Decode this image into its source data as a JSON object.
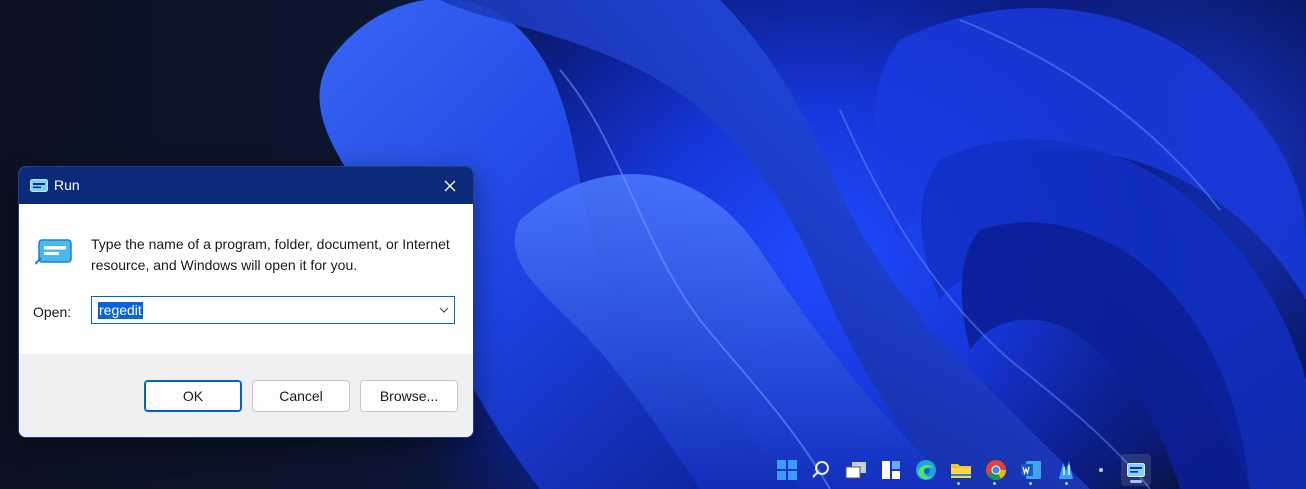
{
  "dialog": {
    "title": "Run",
    "description": "Type the name of a program, folder, document, or Internet resource, and Windows will open it for you.",
    "open_label": "Open:",
    "open_value": "regedit",
    "ok_label": "OK",
    "cancel_label": "Cancel",
    "browse_label": "Browse..."
  },
  "taskbar": {
    "icons": [
      "start-icon",
      "search-icon",
      "task-view-icon",
      "widgets-icon",
      "edge-icon",
      "file-explorer-icon",
      "chrome-icon",
      "word-icon",
      "app-icon",
      "small-dot-icon",
      "run-icon"
    ]
  },
  "colors": {
    "titlebar": "#0c2a7a",
    "accent": "#0067c0",
    "selection": "#0a64d8",
    "footer": "#f0f0f0"
  }
}
